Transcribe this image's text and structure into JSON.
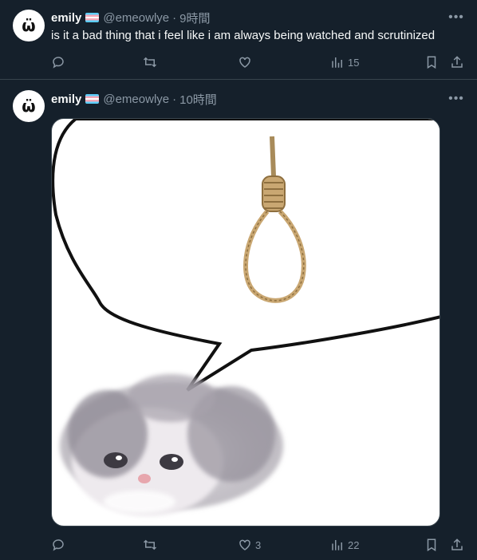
{
  "tweets": [
    {
      "avatar_glyph": "ω̈",
      "display_name": "emily",
      "handle": "@emeowlye",
      "separator": "·",
      "time": "9時間",
      "text": "is it a bad thing that i feel like i am always being watched and scrutinized",
      "likes": "",
      "views": "15"
    },
    {
      "avatar_glyph": "ω̈",
      "display_name": "emily",
      "handle": "@emeowlye",
      "separator": "·",
      "time": "10時間",
      "text": "",
      "likes": "3",
      "views": "22",
      "media_description_icons": [
        "speech-bubble",
        "noose",
        "kitten"
      ]
    }
  ],
  "colors": {
    "background": "#15202b",
    "muted": "#8b98a5",
    "divider": "#38444d",
    "text": "#f7f9f9"
  }
}
